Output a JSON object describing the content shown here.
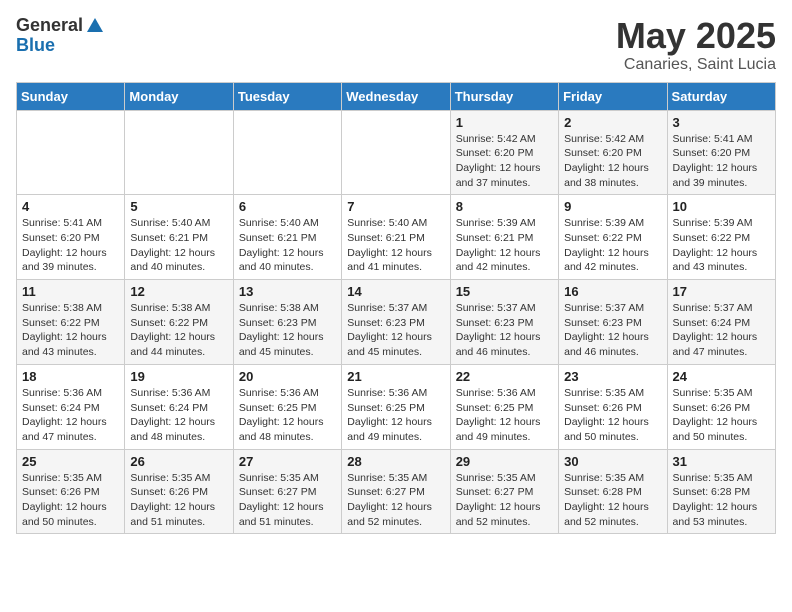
{
  "header": {
    "logo_general": "General",
    "logo_blue": "Blue",
    "month": "May 2025",
    "location": "Canaries, Saint Lucia"
  },
  "days_of_week": [
    "Sunday",
    "Monday",
    "Tuesday",
    "Wednesday",
    "Thursday",
    "Friday",
    "Saturday"
  ],
  "weeks": [
    [
      {
        "day": "",
        "sunrise": "",
        "sunset": "",
        "daylight": ""
      },
      {
        "day": "",
        "sunrise": "",
        "sunset": "",
        "daylight": ""
      },
      {
        "day": "",
        "sunrise": "",
        "sunset": "",
        "daylight": ""
      },
      {
        "day": "",
        "sunrise": "",
        "sunset": "",
        "daylight": ""
      },
      {
        "day": "1",
        "sunrise": "Sunrise: 5:42 AM",
        "sunset": "Sunset: 6:20 PM",
        "daylight": "Daylight: 12 hours and 37 minutes."
      },
      {
        "day": "2",
        "sunrise": "Sunrise: 5:42 AM",
        "sunset": "Sunset: 6:20 PM",
        "daylight": "Daylight: 12 hours and 38 minutes."
      },
      {
        "day": "3",
        "sunrise": "Sunrise: 5:41 AM",
        "sunset": "Sunset: 6:20 PM",
        "daylight": "Daylight: 12 hours and 39 minutes."
      }
    ],
    [
      {
        "day": "4",
        "sunrise": "Sunrise: 5:41 AM",
        "sunset": "Sunset: 6:20 PM",
        "daylight": "Daylight: 12 hours and 39 minutes."
      },
      {
        "day": "5",
        "sunrise": "Sunrise: 5:40 AM",
        "sunset": "Sunset: 6:21 PM",
        "daylight": "Daylight: 12 hours and 40 minutes."
      },
      {
        "day": "6",
        "sunrise": "Sunrise: 5:40 AM",
        "sunset": "Sunset: 6:21 PM",
        "daylight": "Daylight: 12 hours and 40 minutes."
      },
      {
        "day": "7",
        "sunrise": "Sunrise: 5:40 AM",
        "sunset": "Sunset: 6:21 PM",
        "daylight": "Daylight: 12 hours and 41 minutes."
      },
      {
        "day": "8",
        "sunrise": "Sunrise: 5:39 AM",
        "sunset": "Sunset: 6:21 PM",
        "daylight": "Daylight: 12 hours and 42 minutes."
      },
      {
        "day": "9",
        "sunrise": "Sunrise: 5:39 AM",
        "sunset": "Sunset: 6:22 PM",
        "daylight": "Daylight: 12 hours and 42 minutes."
      },
      {
        "day": "10",
        "sunrise": "Sunrise: 5:39 AM",
        "sunset": "Sunset: 6:22 PM",
        "daylight": "Daylight: 12 hours and 43 minutes."
      }
    ],
    [
      {
        "day": "11",
        "sunrise": "Sunrise: 5:38 AM",
        "sunset": "Sunset: 6:22 PM",
        "daylight": "Daylight: 12 hours and 43 minutes."
      },
      {
        "day": "12",
        "sunrise": "Sunrise: 5:38 AM",
        "sunset": "Sunset: 6:22 PM",
        "daylight": "Daylight: 12 hours and 44 minutes."
      },
      {
        "day": "13",
        "sunrise": "Sunrise: 5:38 AM",
        "sunset": "Sunset: 6:23 PM",
        "daylight": "Daylight: 12 hours and 45 minutes."
      },
      {
        "day": "14",
        "sunrise": "Sunrise: 5:37 AM",
        "sunset": "Sunset: 6:23 PM",
        "daylight": "Daylight: 12 hours and 45 minutes."
      },
      {
        "day": "15",
        "sunrise": "Sunrise: 5:37 AM",
        "sunset": "Sunset: 6:23 PM",
        "daylight": "Daylight: 12 hours and 46 minutes."
      },
      {
        "day": "16",
        "sunrise": "Sunrise: 5:37 AM",
        "sunset": "Sunset: 6:23 PM",
        "daylight": "Daylight: 12 hours and 46 minutes."
      },
      {
        "day": "17",
        "sunrise": "Sunrise: 5:37 AM",
        "sunset": "Sunset: 6:24 PM",
        "daylight": "Daylight: 12 hours and 47 minutes."
      }
    ],
    [
      {
        "day": "18",
        "sunrise": "Sunrise: 5:36 AM",
        "sunset": "Sunset: 6:24 PM",
        "daylight": "Daylight: 12 hours and 47 minutes."
      },
      {
        "day": "19",
        "sunrise": "Sunrise: 5:36 AM",
        "sunset": "Sunset: 6:24 PM",
        "daylight": "Daylight: 12 hours and 48 minutes."
      },
      {
        "day": "20",
        "sunrise": "Sunrise: 5:36 AM",
        "sunset": "Sunset: 6:25 PM",
        "daylight": "Daylight: 12 hours and 48 minutes."
      },
      {
        "day": "21",
        "sunrise": "Sunrise: 5:36 AM",
        "sunset": "Sunset: 6:25 PM",
        "daylight": "Daylight: 12 hours and 49 minutes."
      },
      {
        "day": "22",
        "sunrise": "Sunrise: 5:36 AM",
        "sunset": "Sunset: 6:25 PM",
        "daylight": "Daylight: 12 hours and 49 minutes."
      },
      {
        "day": "23",
        "sunrise": "Sunrise: 5:35 AM",
        "sunset": "Sunset: 6:26 PM",
        "daylight": "Daylight: 12 hours and 50 minutes."
      },
      {
        "day": "24",
        "sunrise": "Sunrise: 5:35 AM",
        "sunset": "Sunset: 6:26 PM",
        "daylight": "Daylight: 12 hours and 50 minutes."
      }
    ],
    [
      {
        "day": "25",
        "sunrise": "Sunrise: 5:35 AM",
        "sunset": "Sunset: 6:26 PM",
        "daylight": "Daylight: 12 hours and 50 minutes."
      },
      {
        "day": "26",
        "sunrise": "Sunrise: 5:35 AM",
        "sunset": "Sunset: 6:26 PM",
        "daylight": "Daylight: 12 hours and 51 minutes."
      },
      {
        "day": "27",
        "sunrise": "Sunrise: 5:35 AM",
        "sunset": "Sunset: 6:27 PM",
        "daylight": "Daylight: 12 hours and 51 minutes."
      },
      {
        "day": "28",
        "sunrise": "Sunrise: 5:35 AM",
        "sunset": "Sunset: 6:27 PM",
        "daylight": "Daylight: 12 hours and 52 minutes."
      },
      {
        "day": "29",
        "sunrise": "Sunrise: 5:35 AM",
        "sunset": "Sunset: 6:27 PM",
        "daylight": "Daylight: 12 hours and 52 minutes."
      },
      {
        "day": "30",
        "sunrise": "Sunrise: 5:35 AM",
        "sunset": "Sunset: 6:28 PM",
        "daylight": "Daylight: 12 hours and 52 minutes."
      },
      {
        "day": "31",
        "sunrise": "Sunrise: 5:35 AM",
        "sunset": "Sunset: 6:28 PM",
        "daylight": "Daylight: 12 hours and 53 minutes."
      }
    ]
  ]
}
